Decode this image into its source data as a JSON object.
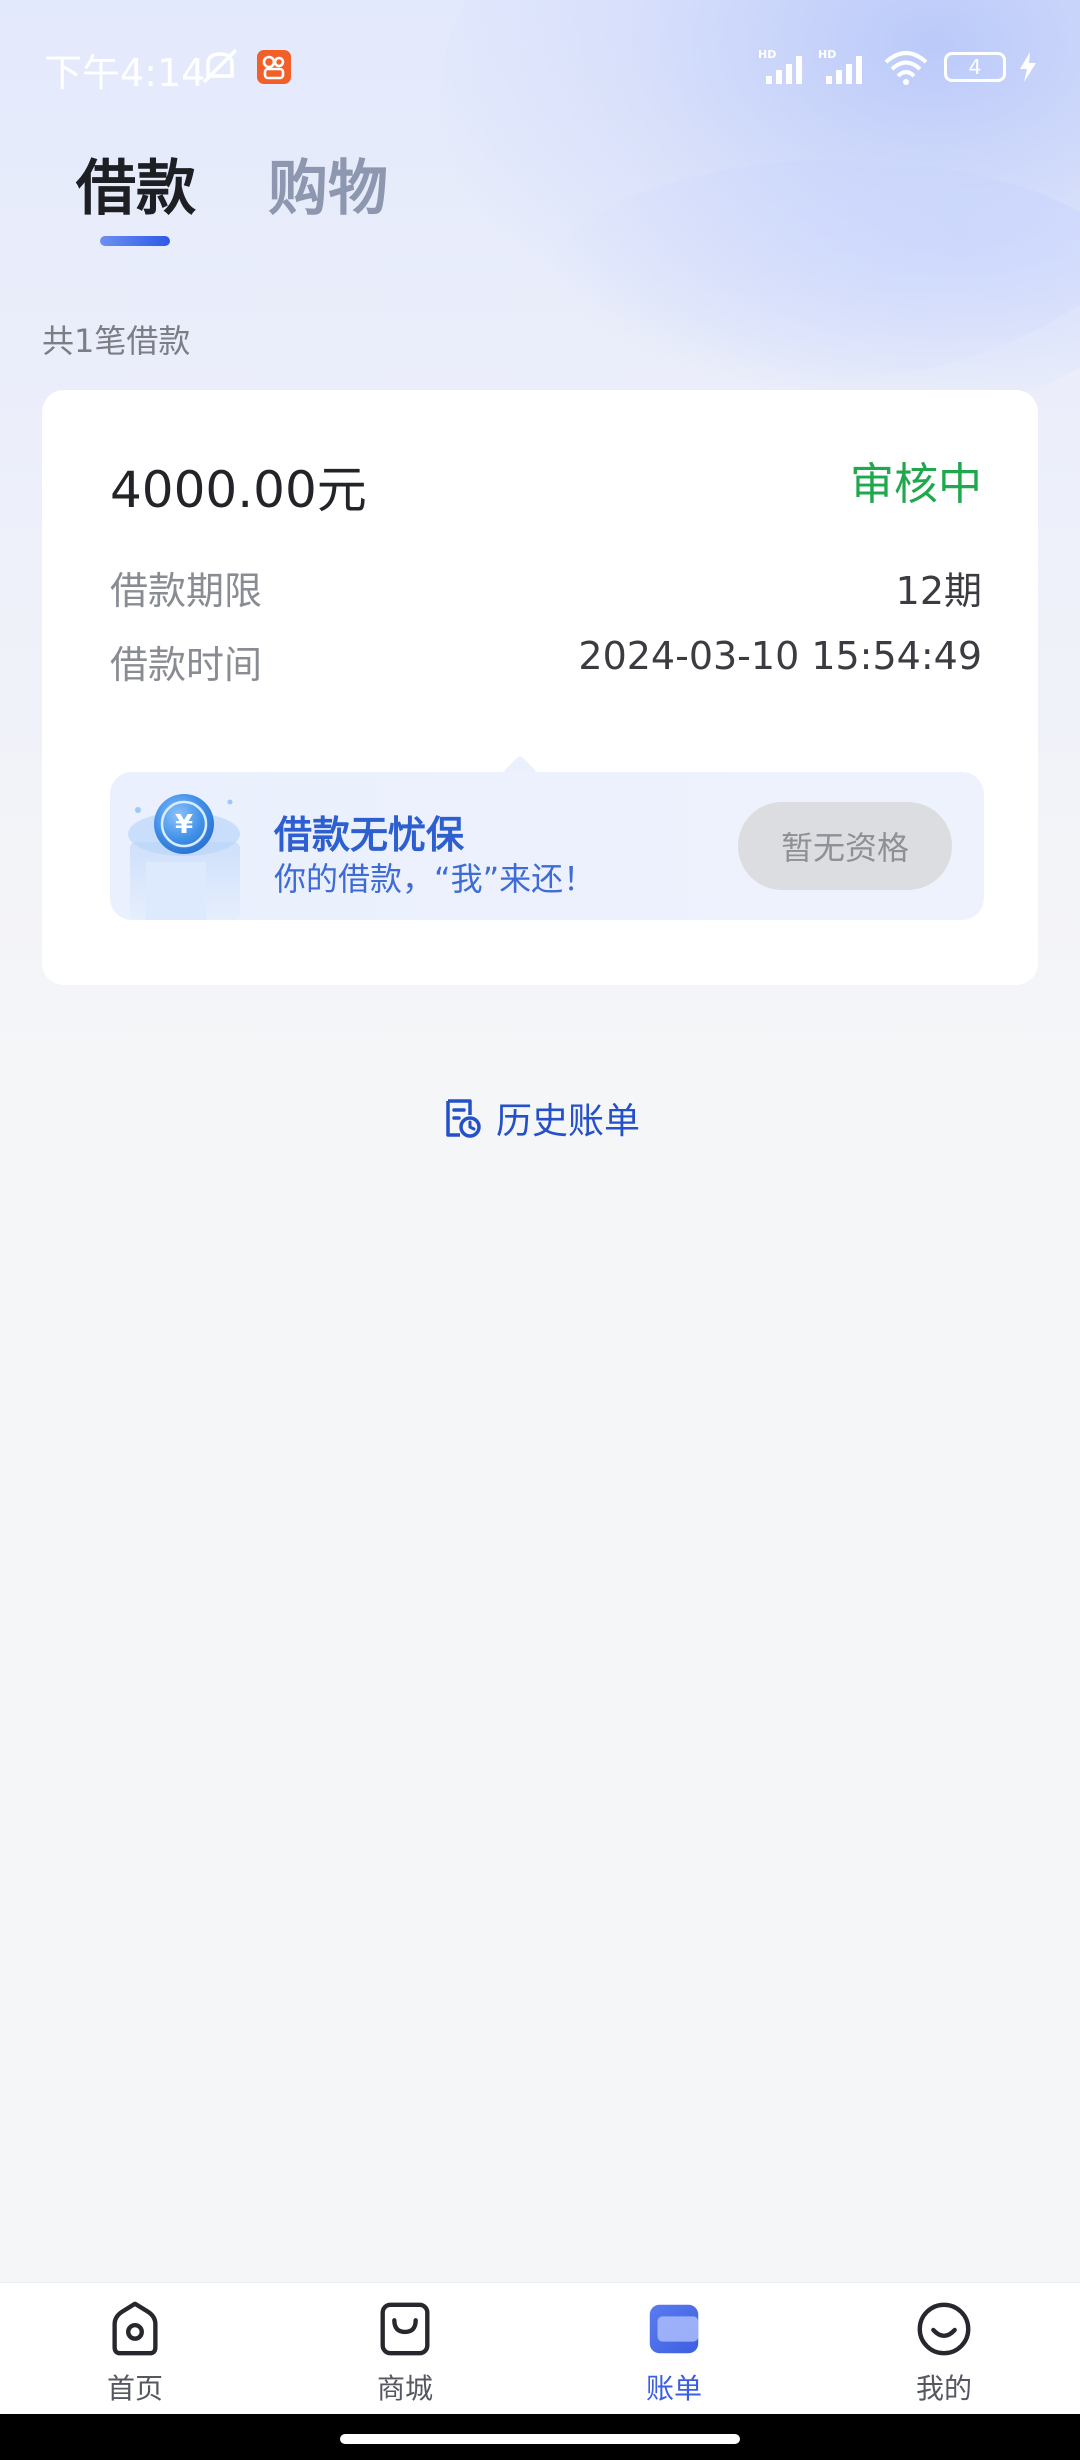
{
  "status_bar": {
    "time": "下午4:14",
    "battery": "4",
    "icons": [
      "mute-icon",
      "app-notification-icon",
      "signal-hd-icon",
      "signal-hd-icon",
      "wifi-icon",
      "battery-icon",
      "charging-icon"
    ]
  },
  "tabs": [
    {
      "label": "借款",
      "active": true
    },
    {
      "label": "购物",
      "active": false
    }
  ],
  "summary": {
    "count_label": "共1笔借款"
  },
  "loan": {
    "amount": "4000.00元",
    "status": "审核中",
    "rows": [
      {
        "label": "借款期限",
        "value": "12期"
      },
      {
        "label": "借款时间",
        "value": "2024-03-10 15:54:49"
      }
    ],
    "insurance": {
      "title": "借款无忧保",
      "subtitle": "你的借款，“我”来还！",
      "button": "暂无资格"
    }
  },
  "history": {
    "label": "历史账单"
  },
  "bottom_nav": [
    {
      "label": "首页",
      "icon": "home-camera-icon",
      "active": false
    },
    {
      "label": "商城",
      "icon": "shopping-bag-icon",
      "active": false
    },
    {
      "label": "账单",
      "icon": "bill-card-icon",
      "active": true
    },
    {
      "label": "我的",
      "icon": "smile-face-icon",
      "active": false
    }
  ],
  "colors": {
    "accent": "#3B5FE0",
    "status_green": "#1FA84D",
    "insurance_blue": "#2D5FD0"
  }
}
